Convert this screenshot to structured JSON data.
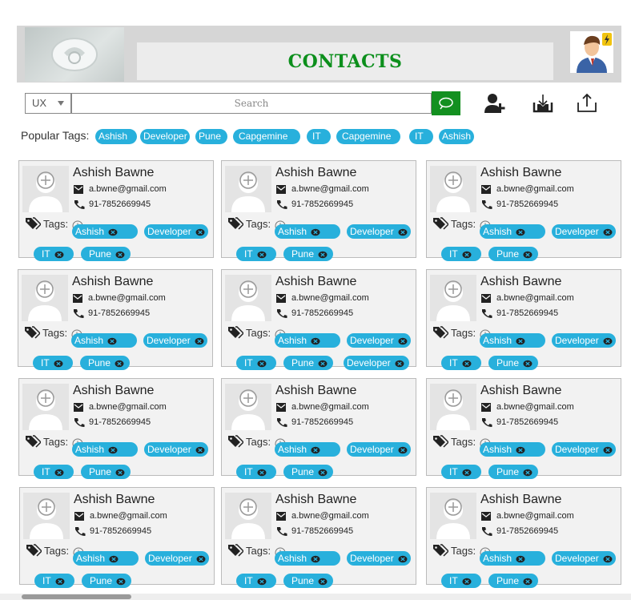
{
  "header": {
    "title": "CONTACTS",
    "logo_icon": "phone-logo-icon",
    "profile_icon": "user-profile-icon"
  },
  "toolbar": {
    "filter_value": "UX",
    "search_placeholder": "Search",
    "icons": [
      "search-icon",
      "add-contact-icon",
      "import-icon",
      "export-icon"
    ]
  },
  "popular_tags": {
    "label": "Popular Tags:",
    "tags": [
      "Ashish",
      "Developer",
      "Pune",
      "Capgemine",
      "IT",
      "Capgemine",
      "IT",
      "Ashish"
    ]
  },
  "contact": {
    "name": "Ashish Bawne",
    "email": "a.bwne@gmail.com",
    "phone": "91-7852669945",
    "tags_label": "Tags:"
  },
  "cards": [
    {
      "tags": [
        "Ashish",
        "Developer",
        "IT",
        "Pune"
      ]
    },
    {
      "tags": [
        "Ashish",
        "Developer",
        "IT",
        "Pune"
      ]
    },
    {
      "tags": [
        "Ashish",
        "Developer",
        "IT",
        "Pune"
      ]
    },
    {
      "tags": [
        "Ashish",
        "Developer",
        "IT",
        "Pune"
      ]
    },
    {
      "tags": [
        "Ashish",
        "Developer",
        "IT",
        "Pune",
        "Developer"
      ]
    },
    {
      "tags": [
        "Ashish",
        "Developer",
        "IT",
        "Pune"
      ]
    },
    {
      "tags": [
        "Ashish",
        "Developer",
        "IT",
        "Pune"
      ]
    },
    {
      "tags": [
        "Ashish",
        "Developer",
        "IT",
        "Pune"
      ]
    },
    {
      "tags": [
        "Ashish",
        "Developer",
        "IT",
        "Pune"
      ]
    },
    {
      "tags": [
        "Ashish",
        "Developer",
        "IT",
        "Pune"
      ]
    },
    {
      "tags": [
        "Ashish",
        "Developer",
        "IT",
        "Pune"
      ]
    },
    {
      "tags": [
        "Ashish",
        "Developer",
        "IT",
        "Pune"
      ]
    }
  ],
  "colors": {
    "accent": "#28b0dc",
    "title_green": "#0c8f1c",
    "search_button": "#139020"
  }
}
